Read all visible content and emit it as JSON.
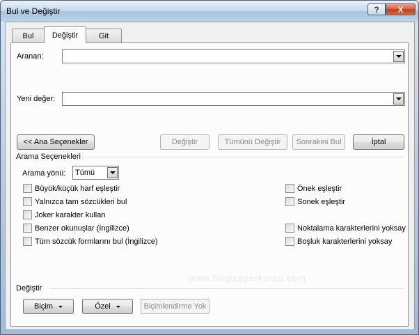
{
  "window": {
    "title": "Bul ve Değiştir",
    "help_glyph": "?",
    "close_glyph": "X"
  },
  "tabs": [
    {
      "label": "Bul",
      "active": false
    },
    {
      "label": "Değiştir",
      "active": true
    },
    {
      "label": "Git",
      "active": false
    }
  ],
  "find": {
    "label": "Aranan:",
    "value": ""
  },
  "replace": {
    "label": "Yeni değer:",
    "value": ""
  },
  "buttons": {
    "less_options": "<< Ana Seçenekler",
    "replace": "Değiştir",
    "replace_all": "Tümünü Değiştir",
    "find_next": "Sonrakini Bul",
    "cancel": "İptal"
  },
  "search_options": {
    "heading": "Arama Seçenekleri",
    "direction_label": "Arama yönü:",
    "direction_value": "Tümü",
    "left_checks": [
      {
        "label": "Büyük/küçük harf eşleştir",
        "checked": false
      },
      {
        "label": "Yalnızca tam sözcükleri bul",
        "checked": false
      },
      {
        "label": "Joker karakter kullan",
        "checked": false
      },
      {
        "label": "Benzer okunuşlar (İngilizce)",
        "checked": false
      },
      {
        "label": "Tüm sözcük formlarını bul (İngilizce)",
        "checked": false
      }
    ],
    "right_checks": [
      {
        "label": "Önek eşleştir",
        "checked": false
      },
      {
        "label": "Sonek eşleştir",
        "checked": false
      },
      {
        "label": "Noktalama karakterlerini yoksay",
        "checked": false
      },
      {
        "label": "Boşluk karakterlerini yoksay",
        "checked": false
      }
    ]
  },
  "replace_section": {
    "heading": "Değiştir",
    "format_button": "Biçim",
    "special_button": "Özel",
    "no_formatting_button": "Biçimlendirme Yok"
  },
  "watermark": "www.bilgisayarkursu.com"
}
